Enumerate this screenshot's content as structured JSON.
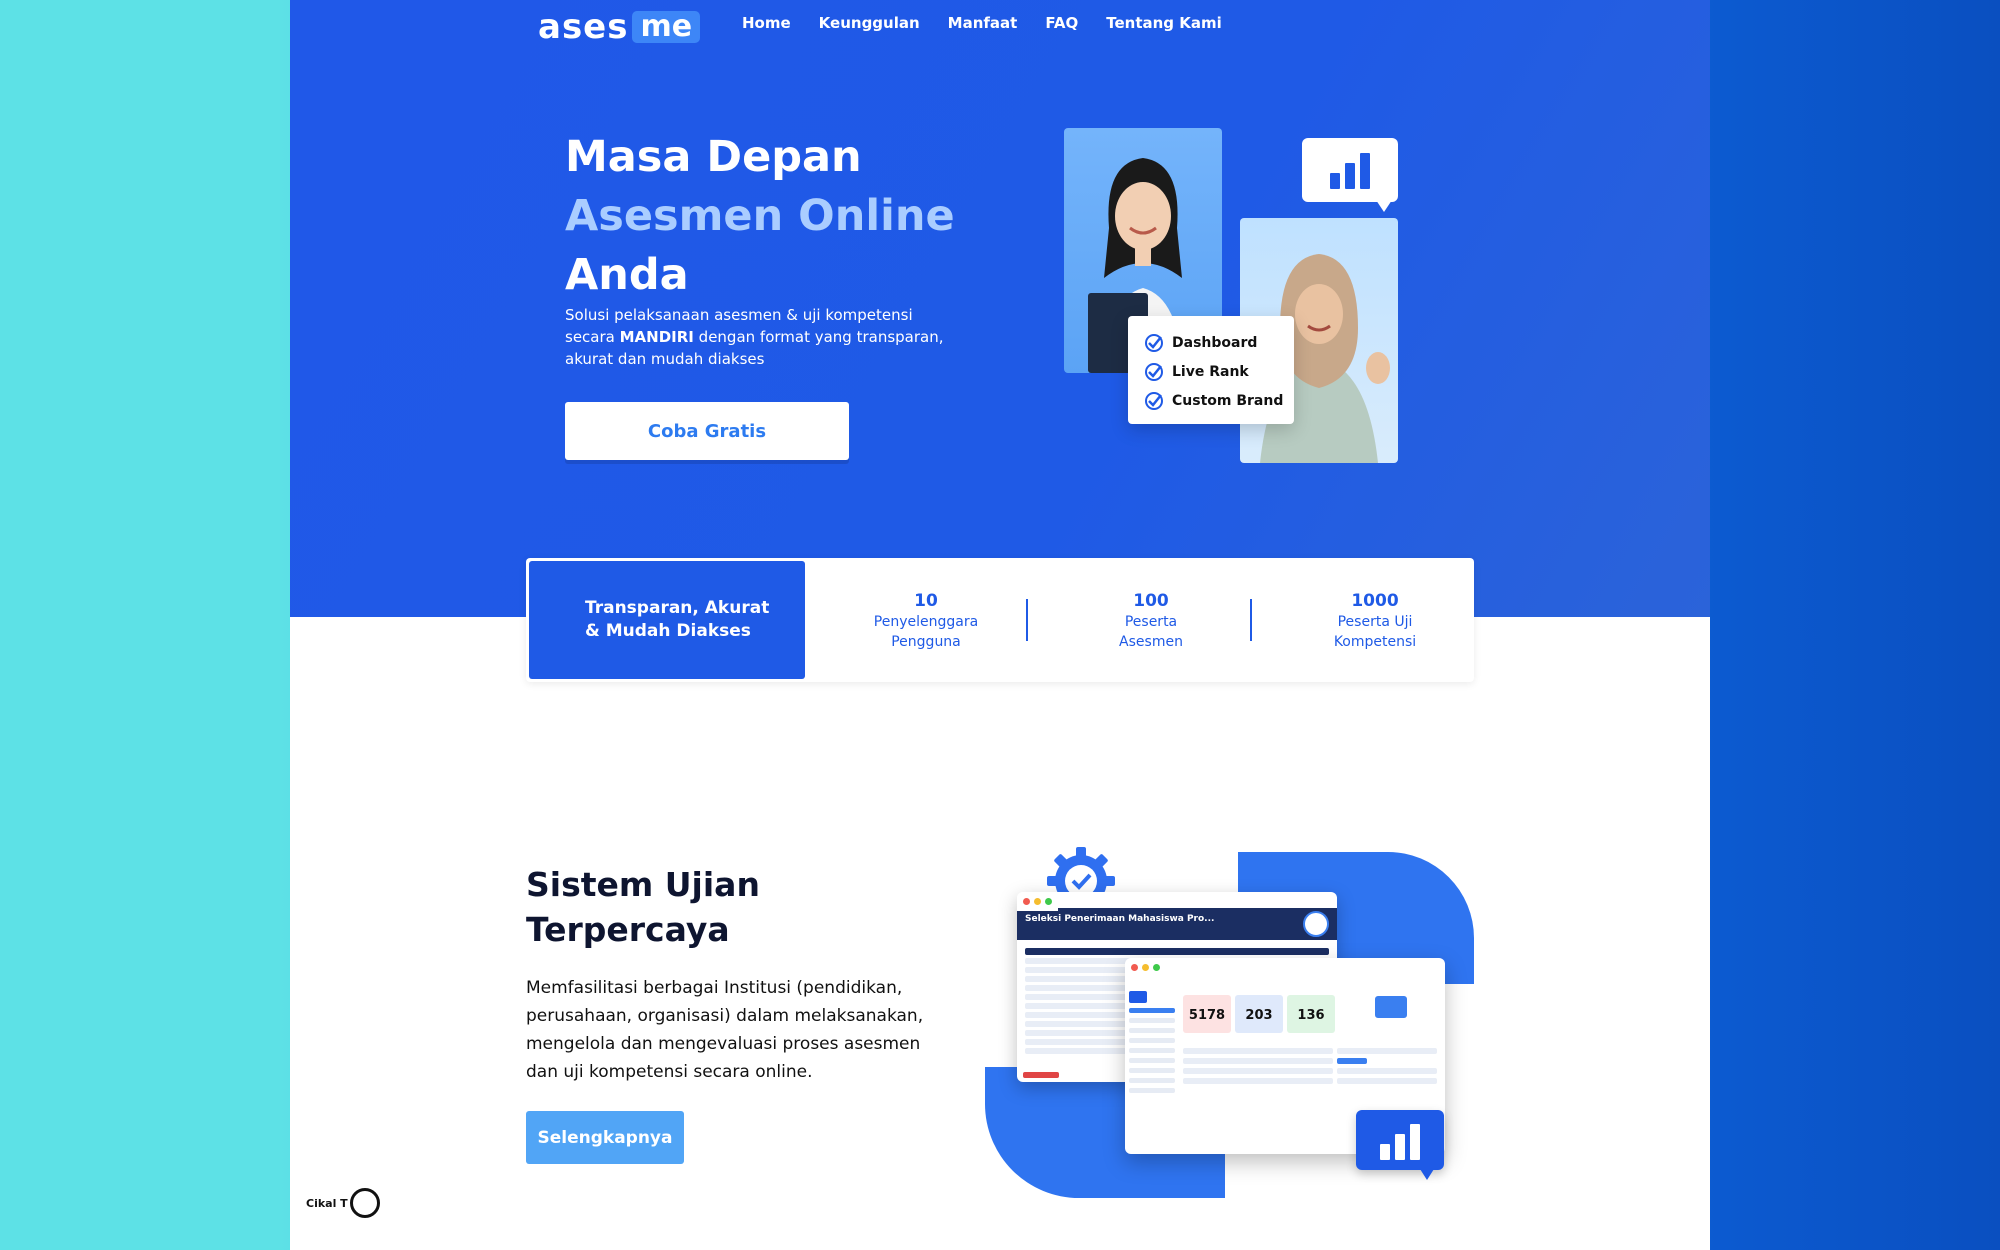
{
  "brand": {
    "logo_left": "ases",
    "logo_right": "me"
  },
  "nav": {
    "items": [
      "Home",
      "Keunggulan",
      "Manfaat",
      "FAQ",
      "Tentang Kami"
    ]
  },
  "hero": {
    "title_line1": "Masa Depan",
    "title_line2": "Asesmen Online",
    "title_line3": "Anda",
    "desc_part1": "Solusi pelaksanaan asesmen & uji kompetensi secara",
    "desc_bold": "MANDIRI",
    "desc_part2": "dengan format yang transparan, akurat dan mudah diakses",
    "cta_label": "Coba Gratis",
    "features": [
      "Dashboard",
      "Live Rank",
      "Custom Brand"
    ]
  },
  "stats": {
    "main_line1": "Transparan, Akurat",
    "main_line2": "& Mudah Diakses",
    "items": [
      {
        "num": "10",
        "label1": "Penyelenggara",
        "label2": "Pengguna"
      },
      {
        "num": "100",
        "label1": "Peserta",
        "label2": "Asesmen"
      },
      {
        "num": "1000",
        "label1": "Peserta Uji",
        "label2": "Kompetensi"
      }
    ]
  },
  "section2": {
    "title_line1": "Sistem Ujian",
    "title_line2": "Terpercaya",
    "desc": "Memfasilitasi berbagai Institusi (pendidikan, perusahaan, organisasi) dalam melaksanakan, mengelola dan mengevaluasi proses asesmen dan uji kompetensi secara online.",
    "cta_label": "Selengkapnya",
    "window1_title": "Seleksi Penerimaan Mahasiswa Pro...",
    "dashboard_values": [
      "5178",
      "203",
      "136"
    ]
  },
  "badge": {
    "text": "Cikal T"
  },
  "colors": {
    "primary": "#1f5ae6",
    "accent_text": "#aacdff",
    "button_light": "#51a5f6",
    "dark_text": "#0e1530"
  }
}
